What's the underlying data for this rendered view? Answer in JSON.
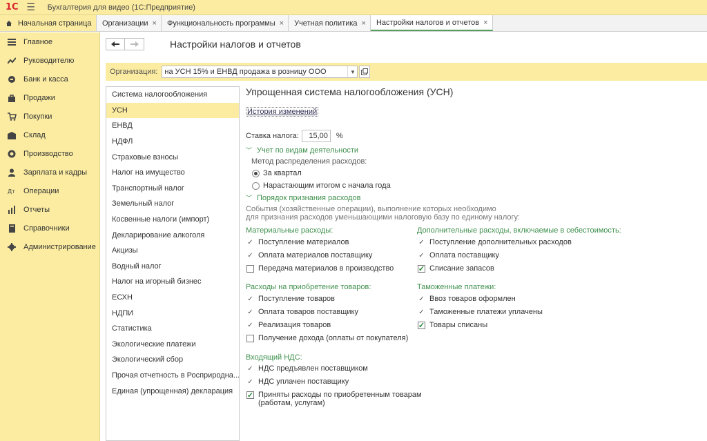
{
  "titlebar": {
    "logo": "1С",
    "title": "Бухгалтерия для видео  (1С:Предприятие)"
  },
  "tabs": {
    "home": "Начальная страница",
    "items": [
      {
        "label": "Организации",
        "active": false
      },
      {
        "label": "Функциональность программы",
        "active": false
      },
      {
        "label": "Учетная политика",
        "active": false
      },
      {
        "label": "Настройки налогов и отчетов",
        "active": true
      }
    ]
  },
  "sidebar": {
    "items": [
      {
        "label": "Главное",
        "icon": "menu-icon"
      },
      {
        "label": "Руководителю",
        "icon": "trend-icon"
      },
      {
        "label": "Банк и касса",
        "icon": "coin-icon"
      },
      {
        "label": "Продажи",
        "icon": "bag-icon"
      },
      {
        "label": "Покупки",
        "icon": "cart-icon"
      },
      {
        "label": "Склад",
        "icon": "warehouse-icon"
      },
      {
        "label": "Производство",
        "icon": "factory-icon"
      },
      {
        "label": "Зарплата и кадры",
        "icon": "person-icon"
      },
      {
        "label": "Операции",
        "icon": "operations-icon"
      },
      {
        "label": "Отчеты",
        "icon": "chart-icon"
      },
      {
        "label": "Справочники",
        "icon": "book-icon"
      },
      {
        "label": "Администрирование",
        "icon": "gear-icon"
      }
    ]
  },
  "form": {
    "title": "Настройки налогов и отчетов",
    "org_label": "Организация:",
    "org_value": "на УСН 15% и ЕНВД продажа в розницу ООО"
  },
  "taxlist": {
    "items": [
      "Система налогообложения",
      "УСН",
      "ЕНВД",
      "НДФЛ",
      "Страховые взносы",
      "Налог на имущество",
      "Транспортный налог",
      "Земельный налог",
      "Косвенные налоги (импорт)",
      "Декларирование алкоголя",
      "Акцизы",
      "Водный налог",
      "Налог на игорный бизнес",
      "ЕСХН",
      "НДПИ",
      "Статистика",
      "Экологические платежи",
      "Экологический сбор",
      "Прочая отчетность в Росприродна...",
      "Единая (упрощенная) декларация"
    ],
    "selected": 1
  },
  "detail": {
    "title": "Упрощенная система налогообложения (УСН)",
    "history": "История изменений",
    "rate_label": "Ставка налога:",
    "rate_value": "15,00",
    "rate_unit": "%",
    "activity_group": "Учет по видам деятельности",
    "method_label": "Метод распределения расходов:",
    "radio1": "За квартал",
    "radio2": "Нарастающим итогом с начала года",
    "recognition_group": "Порядок признания расходов",
    "note1": "События (хозяйственные операции), выполнение которых необходимо",
    "note2": "для признания расходов уменьшающими налоговую базу по единому налогу:",
    "left": {
      "material_head": "Материальные расходы:",
      "material": [
        {
          "label": "Поступление материалов",
          "kind": "check"
        },
        {
          "label": "Оплата материалов поставщику",
          "kind": "check"
        },
        {
          "label": "Передача материалов в производство",
          "kind": "box"
        }
      ],
      "goods_head": "Расходы на приобретение товаров:",
      "goods": [
        {
          "label": "Поступление товаров",
          "kind": "check"
        },
        {
          "label": "Оплата товаров поставщику",
          "kind": "check"
        },
        {
          "label": "Реализация товаров",
          "kind": "check"
        },
        {
          "label": "Получение дохода (оплаты от покупателя)",
          "kind": "box"
        }
      ],
      "vat_head": "Входящий НДС:",
      "vat": [
        {
          "label": "НДС предъявлен поставщиком",
          "kind": "check"
        },
        {
          "label": "НДС уплачен поставщику",
          "kind": "check"
        },
        {
          "label": "Приняты расходы по приобретенным товарам",
          "label2": "(работам, услугам)",
          "kind": "checked"
        }
      ]
    },
    "right": {
      "additional_head": "Дополнительные расходы, включаемые в себестоимость:",
      "additional": [
        {
          "label": "Поступление дополнительных расходов",
          "kind": "check"
        },
        {
          "label": "Оплата поставщику",
          "kind": "check"
        },
        {
          "label": "Списание запасов",
          "kind": "checked"
        }
      ],
      "customs_head": "Таможенные платежи:",
      "customs": [
        {
          "label": "Ввоз товаров оформлен",
          "kind": "check"
        },
        {
          "label": "Таможенные платежи уплачены",
          "kind": "check"
        },
        {
          "label": "Товары списаны",
          "kind": "checked"
        }
      ]
    }
  }
}
